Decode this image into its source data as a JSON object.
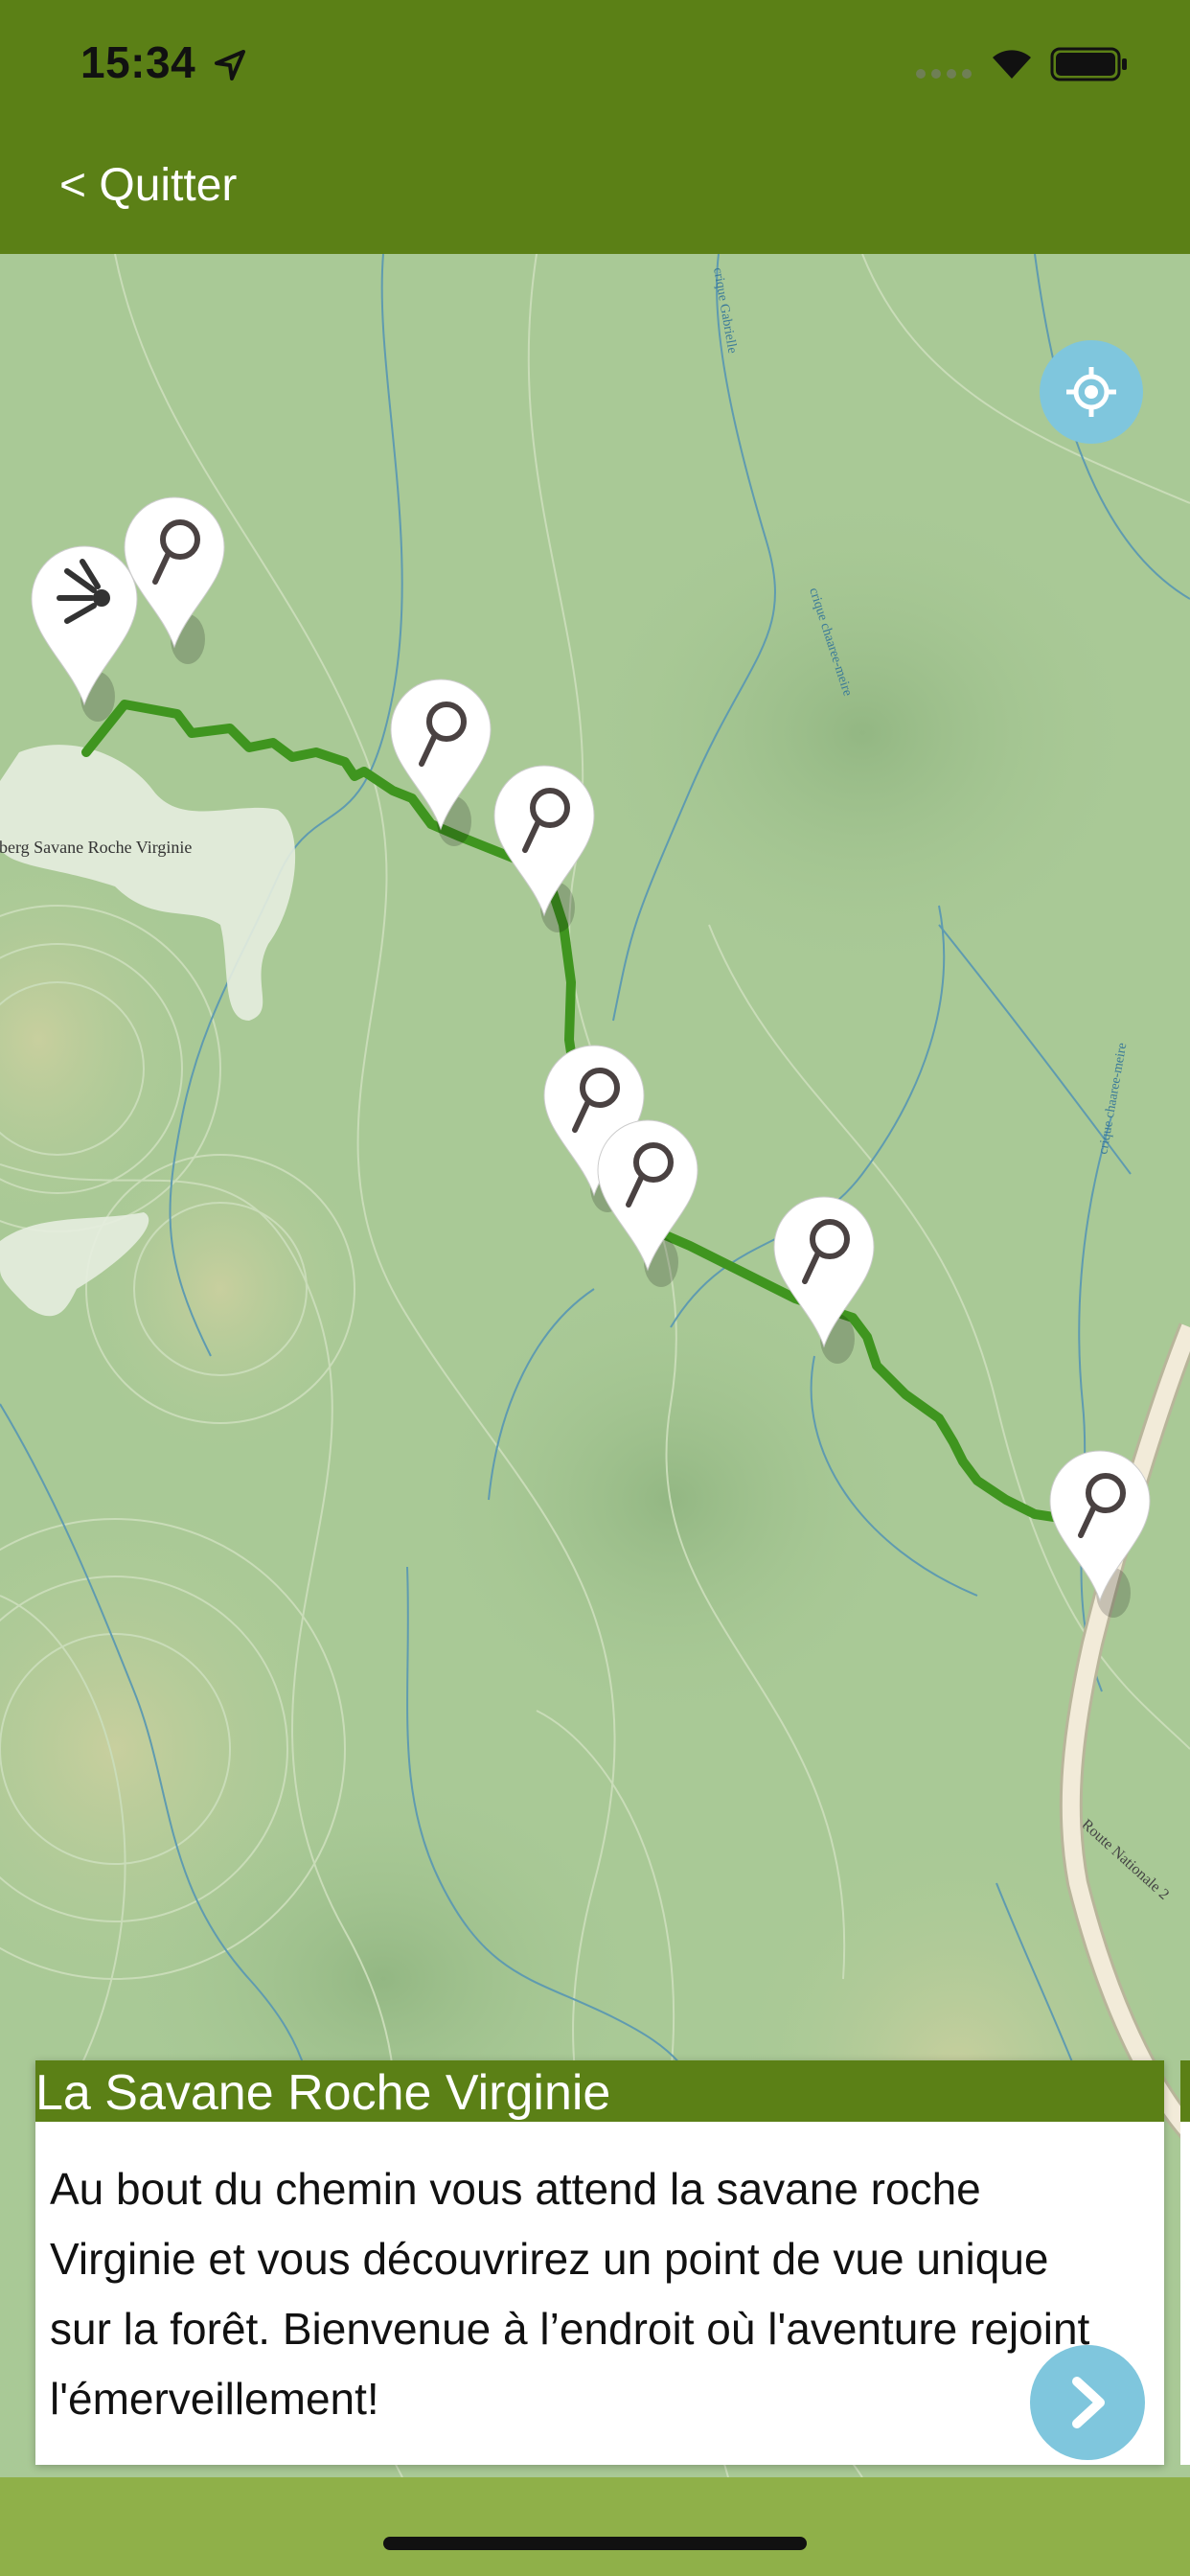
{
  "status_bar": {
    "time": "15:34"
  },
  "nav": {
    "quit_label": "< Quitter"
  },
  "map": {
    "labels": {
      "place_name": "lberg Savane Roche Virginie",
      "road_name": "Route Nationale 2",
      "creek_1": "crique Gabrielle",
      "creek_2": "crique chaaree-meire",
      "creek_3": "crique chaaree-meire"
    },
    "route_color": "#3f951f",
    "markers": [
      "viewpoint-icon",
      "search-icon",
      "search-icon",
      "search-icon",
      "search-icon",
      "search-icon",
      "search-icon",
      "search-icon"
    ]
  },
  "card": {
    "title": "La Savane Roche Virginie",
    "description": "Au bout du chemin vous attend la savane roche Virginie et vous découvrirez un point de vue unique sur la forêt. Bienvenue à l’endroit où l'aventure rejoint l'émerveillement!",
    "next_icon": "chevron-right-icon"
  },
  "colors": {
    "brand_green": "#5b8016",
    "accent_blue": "#7fc6dd",
    "light_green": "#8fb049"
  }
}
